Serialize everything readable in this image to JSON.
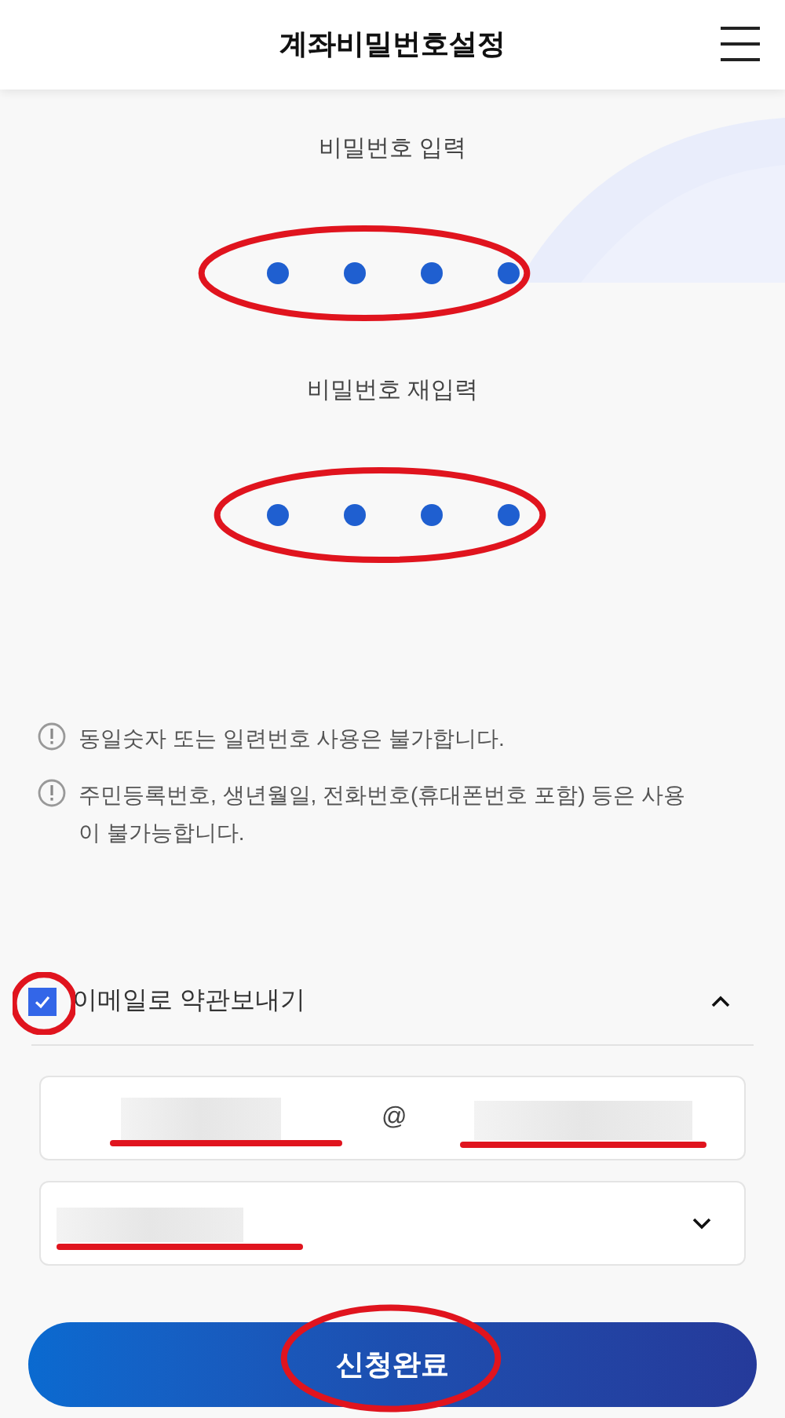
{
  "header": {
    "title": "계좌비밀번호설정"
  },
  "pin_groups": [
    {
      "label": "비밀번호 입력",
      "dots": [
        {
          "filled": true
        },
        {
          "filled": true
        },
        {
          "filled": true
        },
        {
          "filled": true
        }
      ]
    },
    {
      "label": "비밀번호 재입력",
      "dots": [
        {
          "filled": true
        },
        {
          "filled": true
        },
        {
          "filled": true
        },
        {
          "filled": true
        }
      ]
    }
  ],
  "notices": [
    "동일숫자 또는 일련번호 사용은 불가합니다.",
    "주민등록번호, 생년월일, 전화번호(휴대폰번호 포함) 등은 사용이 불가능합니다."
  ],
  "email_option": {
    "label": "이메일로 약관보내기",
    "checked": true,
    "expanded": true,
    "at_sign": "@"
  },
  "submit_button": "신청완료"
}
